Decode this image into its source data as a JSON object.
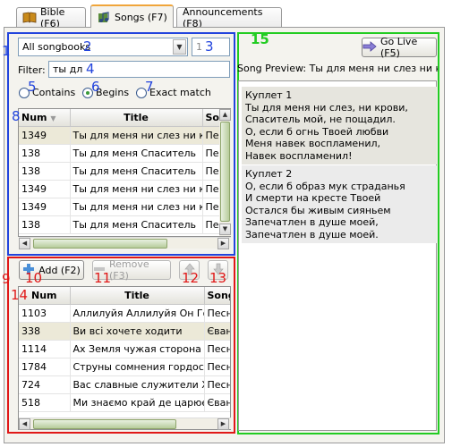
{
  "tabs": [
    {
      "label": "Bible (F6)",
      "icon": "book-icon"
    },
    {
      "label": "Songs (F7)",
      "icon": "music-notes-icon"
    },
    {
      "label": "Announcements (F8)",
      "icon": ""
    }
  ],
  "annotations": {
    "n1": "1",
    "n2": "2",
    "n3": "3",
    "n4": "4",
    "n5": "5",
    "n6": "6",
    "n7": "7",
    "n8": "8",
    "n9": "9",
    "n10": "10",
    "n11": "11",
    "n12": "12",
    "n13": "13",
    "n14": "14",
    "n15": "15"
  },
  "search": {
    "songbook": "All songbooks",
    "spin_value": "1",
    "filter_label": "Filter:",
    "filter_value": "ты дл",
    "mode_contains": "Contains",
    "mode_begins": "Begins",
    "mode_exact": "Exact match",
    "selected_mode": "Begins"
  },
  "results": {
    "columns": [
      "Num",
      "Title",
      "So"
    ],
    "rows": [
      [
        "1349",
        "Ты для меня ни слез ни кр...",
        "Пе"
      ],
      [
        "138",
        "Ты для меня Спаситель",
        "Пе"
      ],
      [
        "138",
        "Ты для меня Спаситель",
        "Пе"
      ],
      [
        "1349",
        "Ты для меня ни слез ни кр...",
        "Пе"
      ],
      [
        "1349",
        "Ты для меня ни слез ни кр...",
        "Пе"
      ],
      [
        "138",
        "Ты для меня Спаситель",
        "Пе"
      ]
    ],
    "selected_row": 0
  },
  "schedule_toolbar": {
    "add_label": "Add (F2)",
    "remove_label": "Remove (F3)",
    "up_icon": "arrow-up-icon",
    "down_icon": "arrow-down-icon"
  },
  "schedule": {
    "columns": [
      "Num",
      "Title",
      "Song"
    ],
    "rows": [
      [
        "1103",
        "Аллилуйя Аллилуйя Он Го...",
        "Песнь"
      ],
      [
        "338",
        "Ви всі хочете ходити",
        "Єванг"
      ],
      [
        "1114",
        "Ах Земля чужая сторона",
        "Песнь"
      ],
      [
        "1784",
        "Струны сомнения гордост...",
        "Песнь"
      ],
      [
        "724",
        "Вас славные служители Х...",
        "Песнь"
      ],
      [
        "518",
        "Ми знаємо край де царює ...",
        "Єванг"
      ]
    ],
    "selected_row": 1
  },
  "preview": {
    "go_live_label": "Go Live (F5)",
    "title": "Song Preview: Ты для меня ни слез ни крови",
    "verses": [
      {
        "name": "Куплет 1",
        "lines": [
          "Ты для меня ни слез, ни крови,",
          "Спаситель мой, не пощадил.",
          "О, если б огнь Твоей любви",
          "Меня навек воспламенил,",
          "Навек воспламенил!"
        ]
      },
      {
        "name": "Куплет 2",
        "lines": [
          "О, если б образ мук страданья",
          "И смерти на кресте Твоей",
          "Остался бы живым сияньем",
          "Запечатлен в душе моей,",
          "Запечатлен в душе моей."
        ]
      }
    ]
  },
  "colors": {
    "annotation_blue": "#2244dd",
    "annotation_red": "#e01818",
    "annotation_green": "#22cc22",
    "active_tab_accent": "#f0a53a"
  }
}
